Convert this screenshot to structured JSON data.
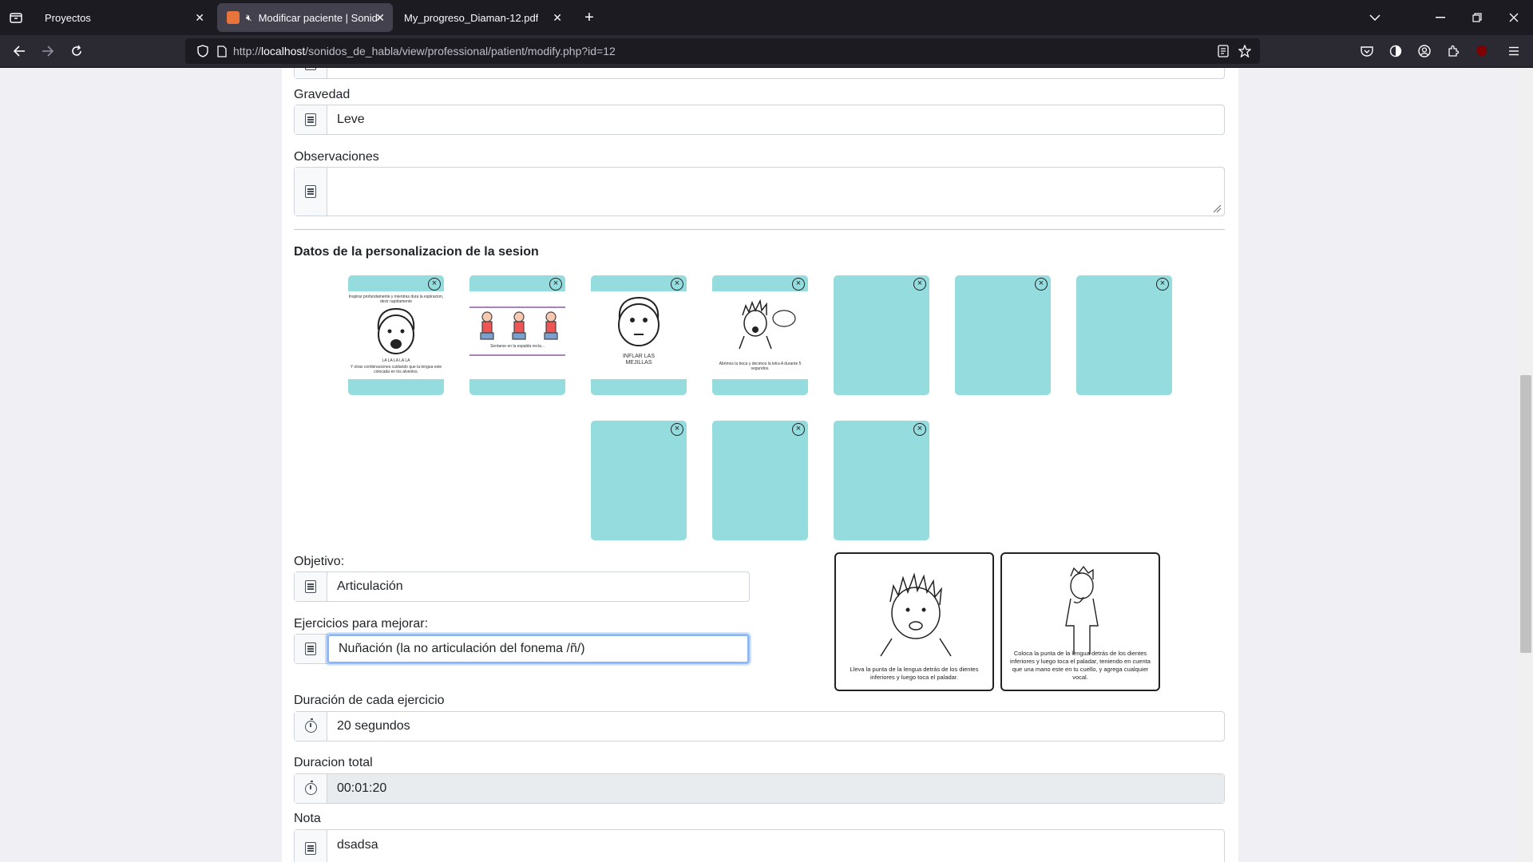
{
  "browser": {
    "tabs": [
      {
        "title": "Proyectos",
        "close": "✕"
      },
      {
        "title": "Modificar paciente | Sonido",
        "close": "✕"
      },
      {
        "title": "My_progreso_Diaman-12.pdf",
        "close": "✕"
      }
    ],
    "new_tab": "+",
    "url_prefix": "http://",
    "url_host": "localhost",
    "url_path": "/sonidos_de_habla/view/professional/patient/modify.php?id=12"
  },
  "form": {
    "gravedad": {
      "label": "Gravedad",
      "value": "Leve"
    },
    "observaciones": {
      "label": "Observaciones",
      "value": ""
    },
    "section_title": "Datos de la personalizacion de la sesion",
    "cards_row1": [
      {
        "caption_top": "Inspirar profundamente y mientras dura la espiracion, decir rapidamente",
        "caption_mid": "LA LA LA LA LA",
        "caption_bottom": "Y otras combinaciones cuidando que la lengua este colocada en los alveolos."
      },
      {
        "caption_bottom": "Sentarse en la espalda recta..."
      },
      {
        "caption_bottom": "INFLAR LAS MEJILLAS"
      },
      {
        "caption_bottom": "Abrimos la boca y decimos la letra A durante 5 segundos."
      },
      {},
      {},
      {}
    ],
    "cards_row2": [
      {},
      {},
      {}
    ],
    "objetivo": {
      "label": "Objetivo:",
      "value": "Articulación"
    },
    "ejercicios": {
      "label": "Ejercicios para mejorar:",
      "value": "Nuñación (la no articulación del fonema /ñ/)"
    },
    "examples": [
      {
        "caption": "Lleva la punta de la lengua detrás de los dientes inferiores y luego toca el paladar."
      },
      {
        "caption": "Coloca la punta de la lengua detrás de los dientes inferiores y luego toca el paladar, teniendo en cuenta que una mano este en tu cuello, y agrega cualquier vocal."
      }
    ],
    "duracion": {
      "label": "Duración de cada ejercicio",
      "value": "20 segundos"
    },
    "duracion_total": {
      "label": "Duracion total",
      "value": "00:01:20"
    },
    "nota": {
      "label": "Nota",
      "value": "dsadsa"
    }
  },
  "colors": {
    "card": "#94dcdd",
    "focus": "#86b7fe",
    "favicon": "#e8743b"
  }
}
